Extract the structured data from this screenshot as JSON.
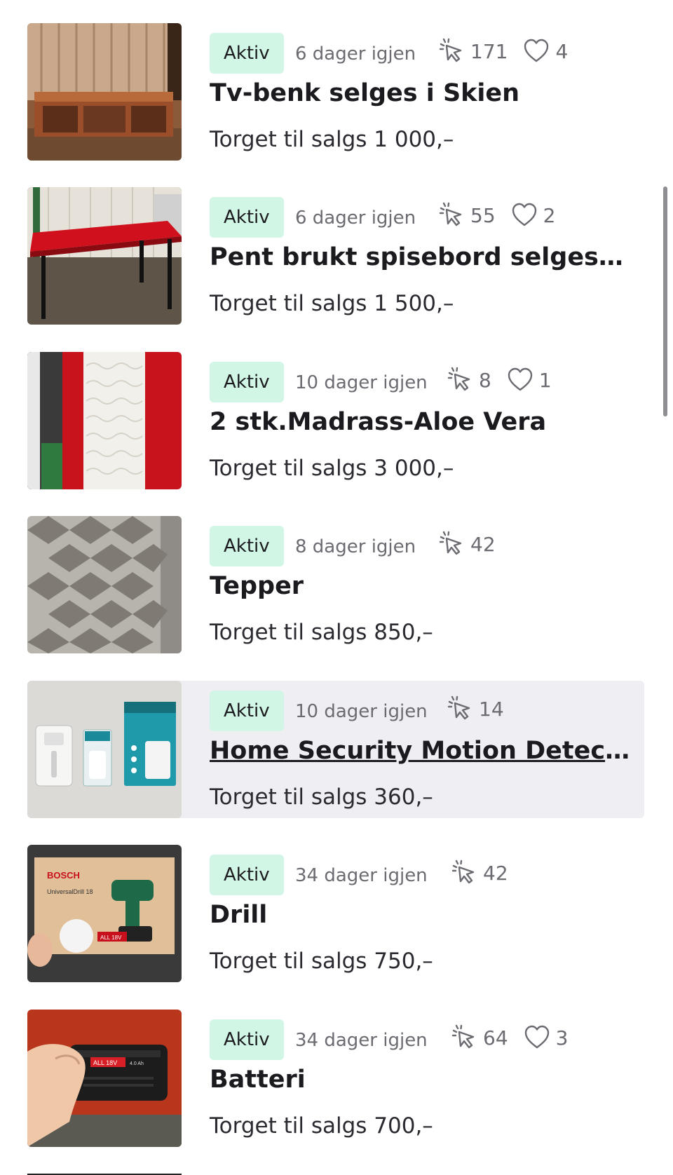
{
  "listings": [
    {
      "status": "Aktiv",
      "time_left": "6 dager igjen",
      "clicks": "171",
      "favorites": "4",
      "title": "Tv-benk selges i Skien",
      "price": "Torget til salgs 1 000,–",
      "thumb": "tv-bench"
    },
    {
      "status": "Aktiv",
      "time_left": "6 dager igjen",
      "clicks": "55",
      "favorites": "2",
      "title": "Pent brukt spisebord selges i S...",
      "price": "Torget til salgs 1 500,–",
      "thumb": "dining-table"
    },
    {
      "status": "Aktiv",
      "time_left": "10 dager igjen",
      "clicks": "8",
      "favorites": "1",
      "title": "2 stk.Madrass-Aloe Vera",
      "price": "Torget til salgs 3 000,–",
      "thumb": "mattress"
    },
    {
      "status": "Aktiv",
      "time_left": "8 dager igjen",
      "clicks": "42",
      "favorites": "",
      "title": "Tepper",
      "price": "Torget til salgs 850,–",
      "thumb": "rug"
    },
    {
      "status": "Aktiv",
      "time_left": "10 dager igjen",
      "clicks": "14",
      "favorites": "",
      "title": "Home Security Motion Detecto...",
      "price": "Torget til salgs 360,–",
      "thumb": "motion-detector"
    },
    {
      "status": "Aktiv",
      "time_left": "34 dager igjen",
      "clicks": "42",
      "favorites": "",
      "title": "Drill",
      "price": "Torget til salgs 750,–",
      "thumb": "drill-box",
      "thumb_text": {
        "brand": "BOSCH",
        "model": "UniversalDrill 18",
        "battery": "ALL 18V"
      }
    },
    {
      "status": "Aktiv",
      "time_left": "34 dager igjen",
      "clicks": "64",
      "favorites": "3",
      "title": "Batteri",
      "price": "Torget til salgs 700,–",
      "thumb": "battery",
      "thumb_text": {
        "battery": "ALL 18V",
        "capacity": "4.0 Ah"
      }
    }
  ],
  "icons": {
    "clicks": "cursor-click-icon",
    "favorites": "heart-icon"
  },
  "colors": {
    "badge_bg": "#d2f6e6",
    "highlight_bg": "#efeff3",
    "muted_text": "#6b6b72"
  }
}
